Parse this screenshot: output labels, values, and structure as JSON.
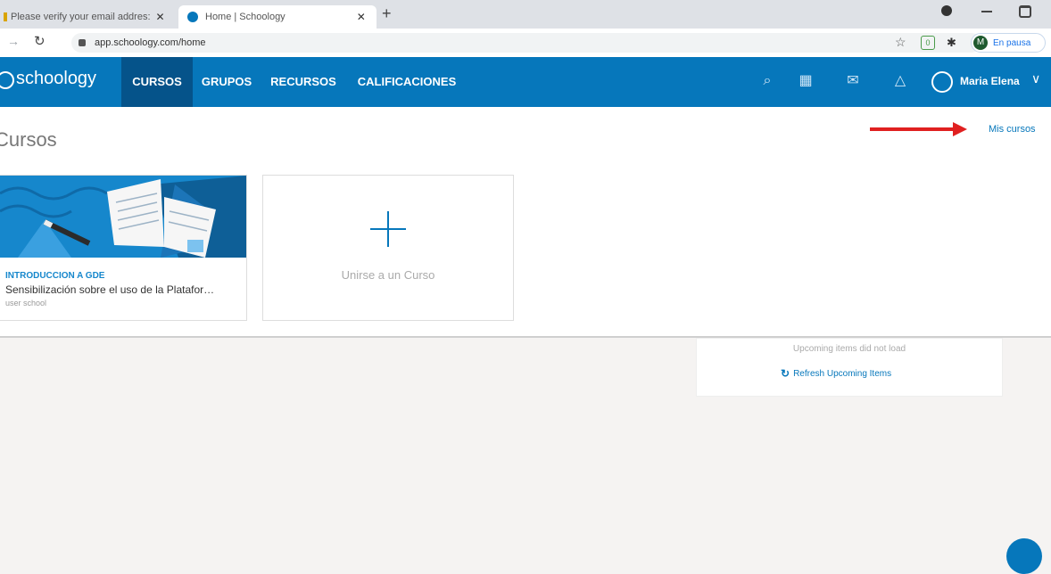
{
  "browser": {
    "tabs": [
      {
        "title": "Please verify your email addres:",
        "close": "✕"
      },
      {
        "title": "Home | Schoology",
        "close": "✕"
      }
    ],
    "new_tab": "+",
    "url": "app.schoology.com/home",
    "profile_initial": "M",
    "profile_status": "En pausa"
  },
  "app": {
    "logo_text": "schoology",
    "nav": [
      "CURSOS",
      "GRUPOS",
      "RECURSOS",
      "CALIFICACIONES"
    ],
    "user_name": "Maria Elena"
  },
  "page": {
    "title": "Cursos",
    "mis_cursos_link": "Mis cursos"
  },
  "courses": [
    {
      "code": "INTRODUCCION A GDE",
      "name": "Sensibilización sobre el uso de la Platafor…",
      "school": "user school"
    }
  ],
  "join_card": {
    "label": "Unirse a un Curso",
    "icon": "plus-icon"
  },
  "upcoming": {
    "message": "Upcoming items did not load",
    "refresh_label": "Refresh Upcoming Items"
  },
  "colors": {
    "header": "#0677bb",
    "nav_active": "#05538a",
    "arrow": "#e02020",
    "link": "#0677bb"
  }
}
